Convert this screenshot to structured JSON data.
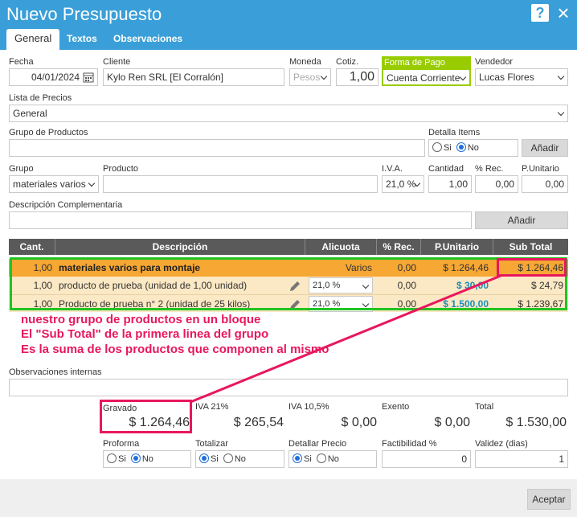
{
  "window": {
    "title": "Nuevo Presupuesto",
    "help": "?",
    "close": "×"
  },
  "tabs": [
    "General",
    "Textos",
    "Observaciones"
  ],
  "fields": {
    "fecha_label": "Fecha",
    "fecha": "04/01/2024",
    "cliente_label": "Cliente",
    "cliente": "Kylo Ren SRL [El Corralón]",
    "moneda_label": "Moneda",
    "moneda": "Pesos",
    "cotiz_label": "Cotiz.",
    "cotiz": "1,00",
    "forma_pago_label": "Forma de Pago",
    "forma_pago": "Cuenta Corriente",
    "vendedor_label": "Vendedor",
    "vendedor": "Lucas Flores",
    "lista_precios_label": "Lista de Precios",
    "lista_precios": "General",
    "grupo_productos_label": "Grupo de Productos",
    "grupo_productos": "",
    "detalla_items_label": "Detalla Items",
    "si": "Si",
    "no": "No",
    "anadir": "Añadir",
    "grupo_label": "Grupo",
    "grupo": "materiales varios",
    "producto_label": "Producto",
    "producto": "",
    "iva_label": "I.V.A.",
    "iva": "21,0 %",
    "cantidad_label": "Cantidad",
    "cantidad": "1,00",
    "rec_label": "% Rec.",
    "rec": "0,00",
    "punitario_label": "P.Unitario",
    "punitario": "0,00",
    "desc_comp_label": "Descripción Complementaria",
    "desc_comp": ""
  },
  "grid": {
    "headers": [
      "Cant.",
      "Descripción",
      "Alicuota",
      "% Rec.",
      "P.Unitario",
      "Sub Total"
    ],
    "rows": [
      {
        "cant": "1,00",
        "desc": "materiales varios para montaje",
        "alicuota": "Varios",
        "rec": "0,00",
        "punit": "$ 1.264,46",
        "subtotal": "$ 1.264,46"
      },
      {
        "cant": "1,00",
        "desc": "producto de prueba (unidad de 1,00 unidad)",
        "alicuota": "21,0 %",
        "rec": "0,00",
        "punit": "$ 30,00",
        "subtotal": "$ 24,79"
      },
      {
        "cant": "1,00",
        "desc": "Producto de prueba n° 2 (unidad de 25 kilos)",
        "alicuota": "21,0 %",
        "rec": "0,00",
        "punit": "$ 1.500,00",
        "subtotal": "$ 1.239,67"
      }
    ]
  },
  "annotation": {
    "line1": "nuestro grupo de productos en un bloque",
    "line2": "El \"Sub Total\" de la primera linea del grupo",
    "line3": "Es la suma de los productos que componen al mismo"
  },
  "obs_label": "Observaciones internas",
  "totals": {
    "gravado_label": "Gravado",
    "gravado": "$ 1.264,46",
    "iva21_label": "IVA 21%",
    "iva21": "$ 265,54",
    "iva105_label": "IVA 10,5%",
    "iva105": "$ 0,00",
    "exento_label": "Exento",
    "exento": "$ 0,00",
    "total_label": "Total",
    "total": "$ 1.530,00"
  },
  "bottom": {
    "proforma_label": "Proforma",
    "totalizar_label": "Totalizar",
    "detallar_label": "Detallar Precio",
    "factibilidad_label": "Factibilidad %",
    "factibilidad": "0",
    "validez_label": "Validez (dias)",
    "validez": "1"
  },
  "accept": "Aceptar",
  "colors": {
    "header": "#3a9fd8",
    "annotation": "#e8175d",
    "group_border": "#22c322",
    "forma_pago_border": "#99cc00"
  }
}
